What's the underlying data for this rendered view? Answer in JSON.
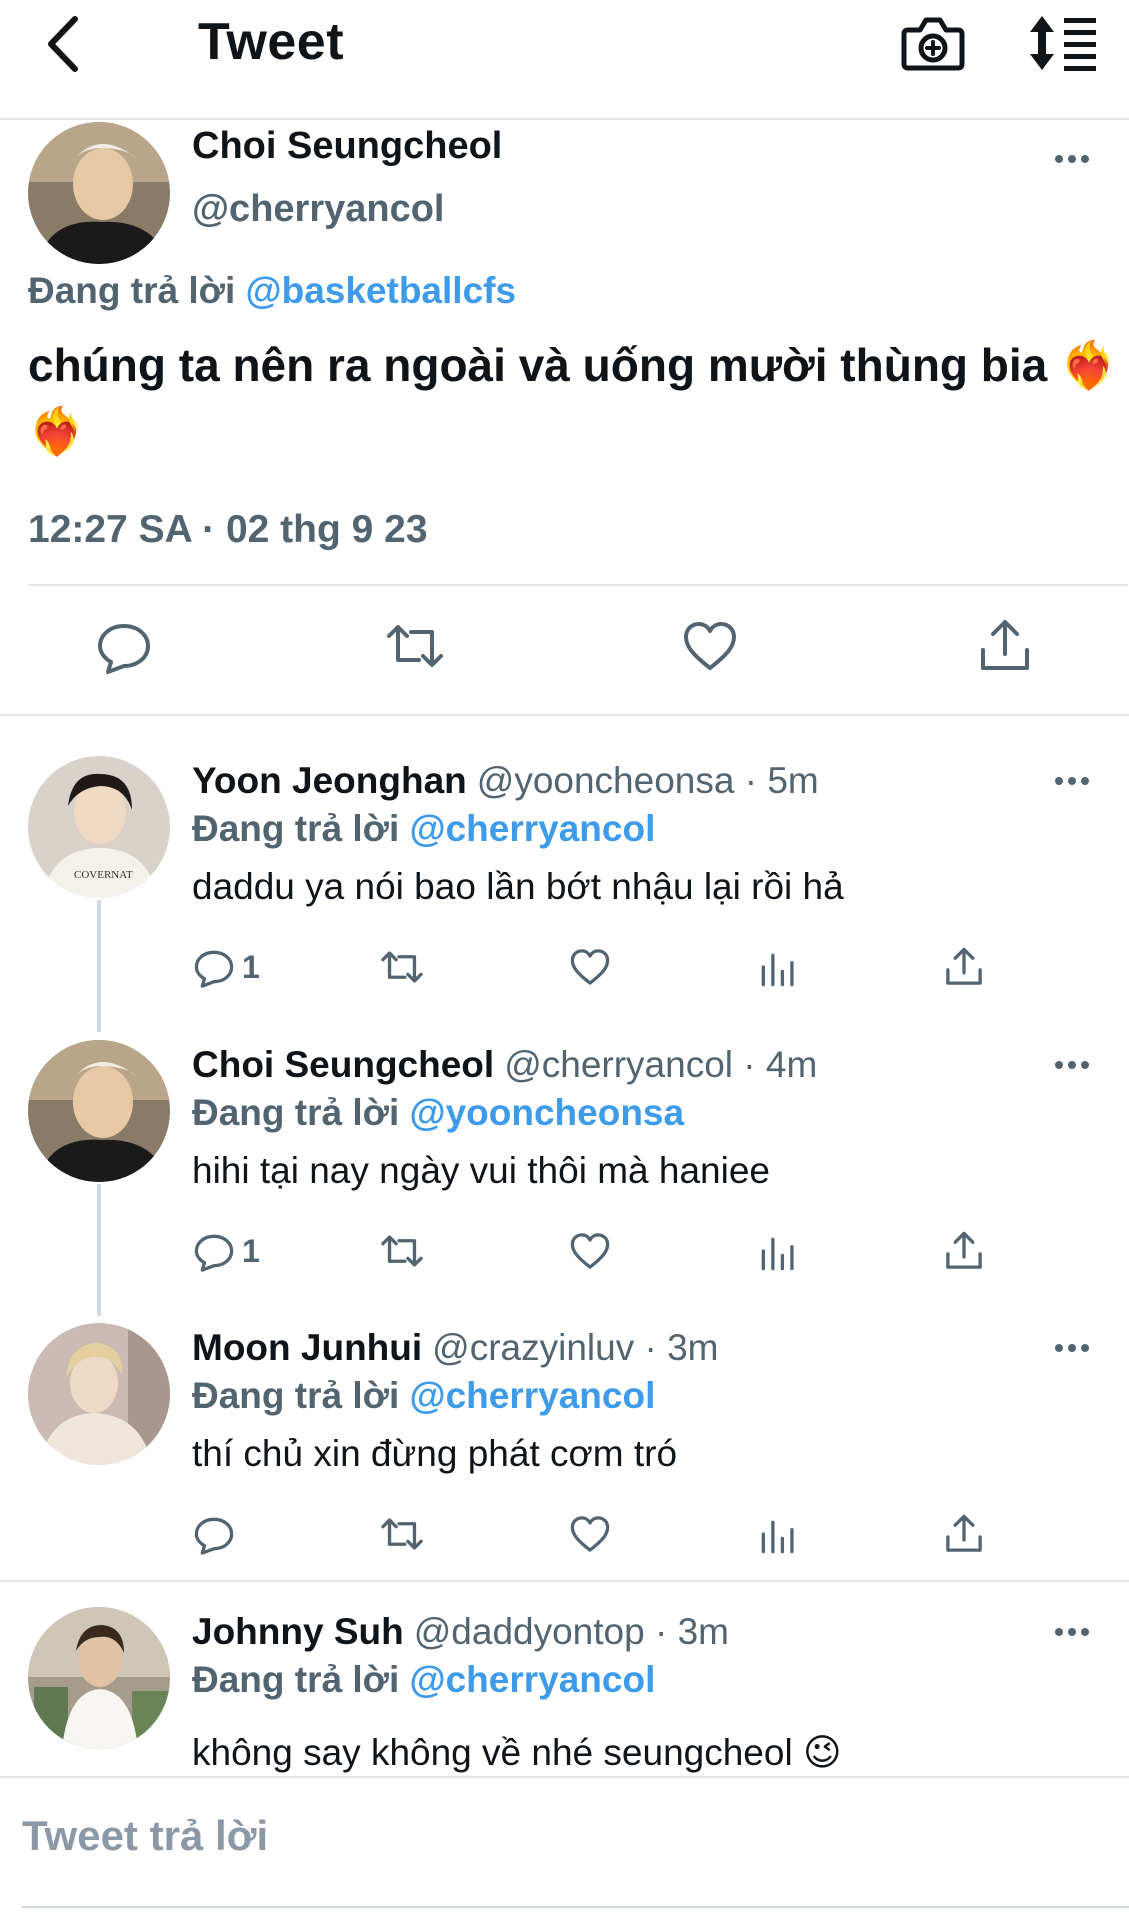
{
  "colors": {
    "accent": "#3d9be9",
    "text": "#0f1419",
    "secondary": "#536471",
    "divider": "#e3e6e9"
  },
  "header": {
    "title": "Tweet",
    "icons": [
      "back-chevron-icon",
      "camera-plus-icon",
      "sort-lines-icon"
    ]
  },
  "main_tweet": {
    "name": "Choi Seungcheol",
    "handle": "@cherryancol",
    "reply_prefix": "Đang trả lời",
    "reply_to": "@basketballcfs",
    "text": "chúng ta nên ra ngoài và uống mười thùng bia",
    "emoji": "❤️‍🔥 ❤️‍🔥",
    "timestamp": "12:27 SA · 02 thg 9 23",
    "actions": [
      "reply-icon",
      "retweet-icon",
      "like-icon",
      "share-icon"
    ]
  },
  "replies": [
    {
      "name": "Yoon Jeonghan",
      "meta": "@yooncheonsa · 5m",
      "reply_prefix": "Đang trả lời",
      "reply_to": "@cherryancol",
      "text": "daddu ya nói bao lần bớt nhậu lại rồi hả",
      "reply_count": "1"
    },
    {
      "name": "Choi Seungcheol",
      "meta": "@cherryancol · 4m",
      "reply_prefix": "Đang trả lời",
      "reply_to": "@yooncheonsa",
      "text": "hihi tại nay ngày vui thôi mà haniee",
      "reply_count": "1"
    },
    {
      "name": "Moon Junhui",
      "meta": "@crazyinluv · 3m",
      "reply_prefix": "Đang trả lời",
      "reply_to": "@cherryancol",
      "text": "thí chủ xin đừng phát cơm tró",
      "reply_count": ""
    },
    {
      "name": "Johnny Suh",
      "meta": "@daddyontop · 3m",
      "reply_prefix": "Đang trả lời",
      "reply_to": "@cherryancol",
      "text": "không say không về nhé seungcheol",
      "emoji": "😉",
      "reply_count": ""
    }
  ],
  "composer": {
    "placeholder": "Tweet trả lời"
  }
}
